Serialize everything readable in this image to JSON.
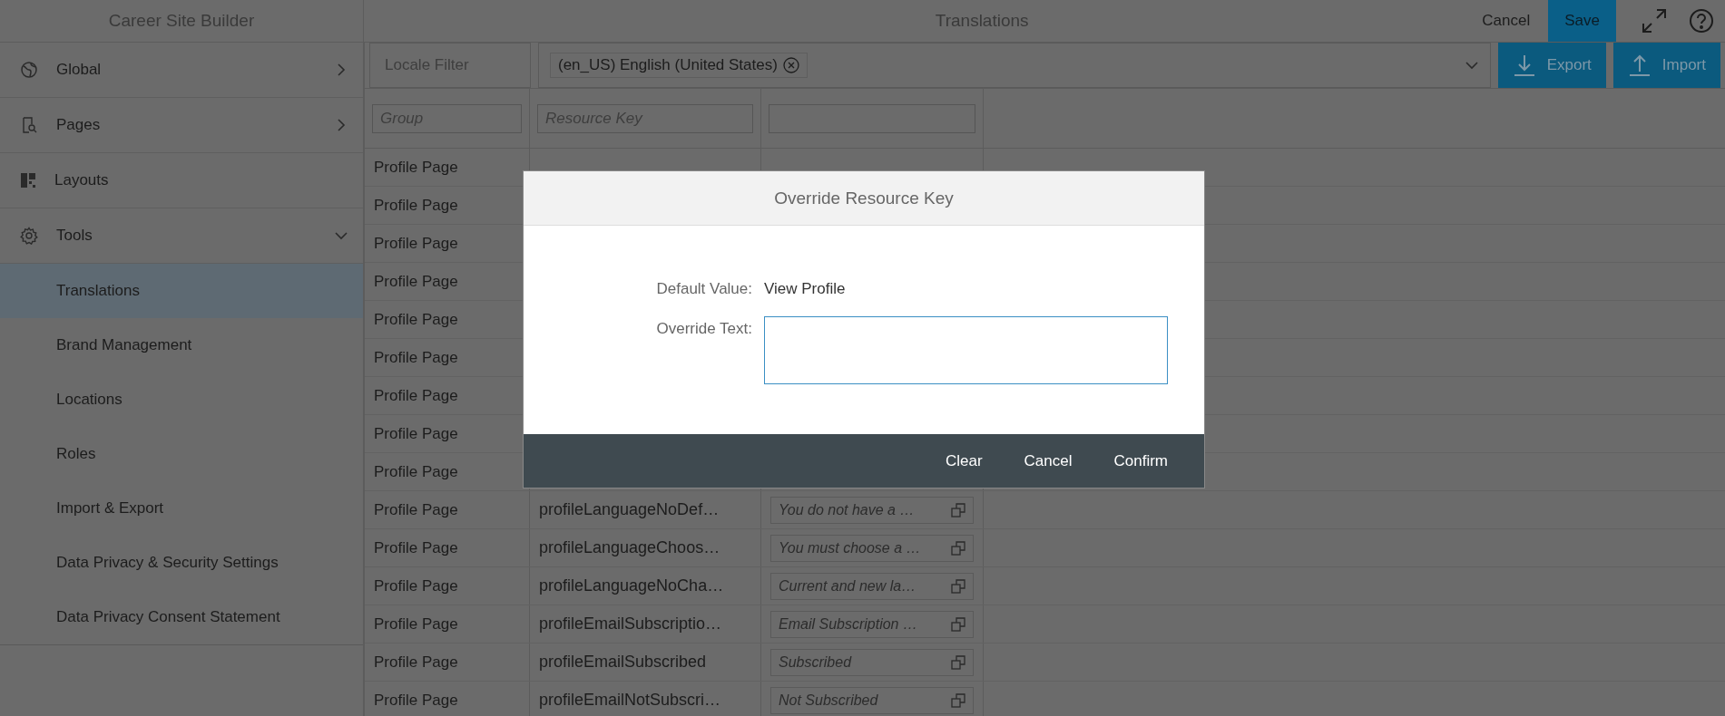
{
  "header": {
    "app_title": "Career Site Builder",
    "page_title": "Translations",
    "cancel": "Cancel",
    "save": "Save"
  },
  "sidebar": {
    "items": [
      {
        "label": "Global",
        "kind": "folder",
        "expanded": false
      },
      {
        "label": "Pages",
        "kind": "folder",
        "expanded": false
      },
      {
        "label": "Layouts",
        "kind": "link"
      },
      {
        "label": "Tools",
        "kind": "folder",
        "expanded": true,
        "children": [
          {
            "label": "Translations",
            "selected": true
          },
          {
            "label": "Brand Management",
            "selected": false
          },
          {
            "label": "Locations",
            "selected": false
          },
          {
            "label": "Roles",
            "selected": false
          },
          {
            "label": "Import & Export",
            "selected": false
          },
          {
            "label": "Data Privacy & Security Settings",
            "selected": false
          },
          {
            "label": "Data Privacy Consent Statement",
            "selected": false
          }
        ]
      }
    ]
  },
  "filters": {
    "locale_filter": "Locale Filter",
    "selected_locales": [
      "(en_US) English (United States)"
    ],
    "export": "Export",
    "import": "Import"
  },
  "table": {
    "column_filters": [
      {
        "placeholder": "Group"
      },
      {
        "placeholder": "Resource Key"
      }
    ],
    "rows": [
      {
        "group": "Profile Page"
      },
      {
        "group": "Profile Page"
      },
      {
        "group": "Profile Page"
      },
      {
        "group": "Profile Page"
      },
      {
        "group": "Profile Page"
      },
      {
        "group": "Profile Page"
      },
      {
        "group": "Profile Page"
      },
      {
        "group": "Profile Page"
      },
      {
        "group": "Profile Page"
      },
      {
        "group": "Profile Page",
        "resource_key": "profileLanguageNoDef…",
        "value": "You do not have a …"
      },
      {
        "group": "Profile Page",
        "resource_key": "profileLanguageChoos…",
        "value": "You must choose a …"
      },
      {
        "group": "Profile Page",
        "resource_key": "profileLanguageNoCha…",
        "value": "Current and new la…"
      },
      {
        "group": "Profile Page",
        "resource_key": "profileEmailSubscriptio…",
        "value": "Email Subscription …"
      },
      {
        "group": "Profile Page",
        "resource_key": "profileEmailSubscribed",
        "value": "Subscribed"
      },
      {
        "group": "Profile Page",
        "resource_key": "profileEmailNotSubscri…",
        "value": "Not Subscribed"
      }
    ]
  },
  "dialog": {
    "title": "Override Resource Key",
    "default_label": "Default Value:",
    "default_value": "View Profile",
    "override_label": "Override Text:",
    "buttons": [
      "Clear",
      "Cancel",
      "Confirm"
    ]
  }
}
